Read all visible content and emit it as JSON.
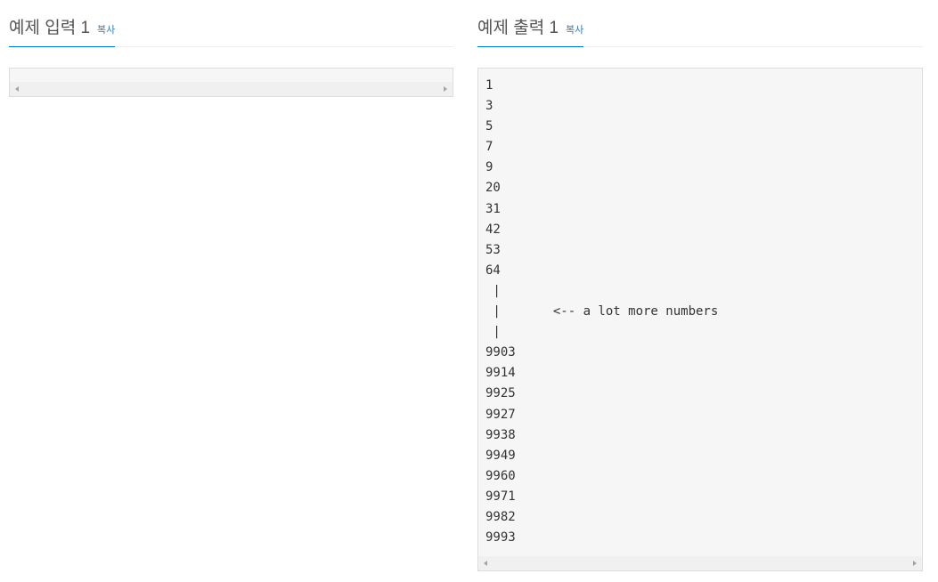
{
  "input_panel": {
    "title": "예제 입력 1",
    "copy_label": "복사",
    "lines": []
  },
  "output_panel": {
    "title": "예제 출력 1",
    "copy_label": "복사",
    "lines": [
      "1",
      "3",
      "5",
      "7",
      "9",
      "20",
      "31",
      "42",
      "53",
      "64",
      " |",
      " |       <-- a lot more numbers",
      " |",
      "9903",
      "9914",
      "9925",
      "9927",
      "9938",
      "9949",
      "9960",
      "9971",
      "9982",
      "9993"
    ]
  },
  "icons": {
    "scroll_left": "chevron-left-icon",
    "scroll_right": "chevron-right-icon"
  },
  "colors": {
    "accent": "#0076c0",
    "link": "#337ab7",
    "pre_background": "#f6f6f7",
    "pre_border": "#dddddd"
  }
}
